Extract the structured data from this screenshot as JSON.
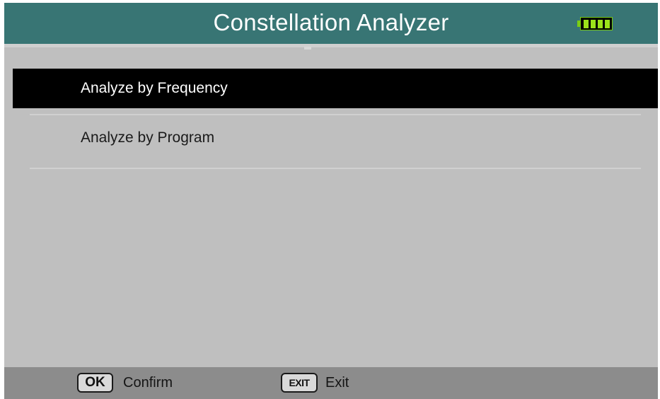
{
  "header": {
    "title": "Constellation Analyzer",
    "battery_icon": "battery-full-icon",
    "battery_color": "#9be21a",
    "background_color": "#387574"
  },
  "menu": {
    "items": [
      {
        "label": "Analyze by Frequency",
        "selected": true
      },
      {
        "label": "Analyze by Program",
        "selected": false
      }
    ]
  },
  "footer": {
    "ok_key": "OK",
    "ok_action": "Confirm",
    "exit_key": "EXIT",
    "exit_action": "Exit"
  }
}
